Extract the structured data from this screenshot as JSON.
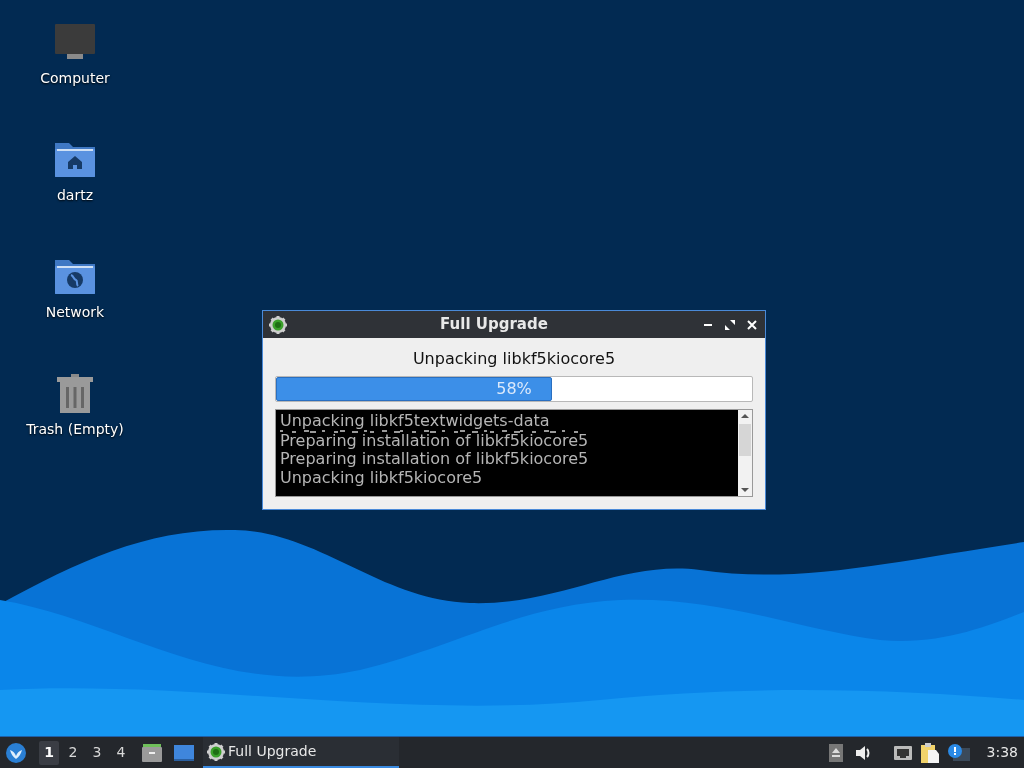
{
  "desktop_icons": [
    {
      "kind": "computer",
      "label": "Computer"
    },
    {
      "kind": "home",
      "label": "dartz"
    },
    {
      "kind": "network",
      "label": "Network"
    },
    {
      "kind": "trash",
      "label": "Trash (Empty)"
    }
  ],
  "dialog": {
    "title": "Full Upgrade",
    "status": "Unpacking libkf5kiocore5",
    "progress": {
      "level": 0.58,
      "reading": "58%"
    },
    "log": [
      {
        "kind": "line",
        "text": "Unpacking libkf5textwidgets-data"
      },
      {
        "kind": "glitched",
        "text": "Preparing installation of libkf5kiocore5"
      },
      {
        "kind": "line",
        "text": "Preparing installation of libkf5kiocore5"
      },
      {
        "kind": "line",
        "text": "Unpacking libkf5kiocore5"
      }
    ]
  },
  "taskbar": {
    "workspaces": [
      {
        "label": "1",
        "selected": true
      },
      {
        "label": "2",
        "selected": false
      },
      {
        "label": "3",
        "selected": false
      },
      {
        "label": "4",
        "selected": false
      }
    ],
    "tasks": [
      {
        "label": "Full Upgrade",
        "selected": true
      }
    ],
    "clock": "3:38"
  }
}
